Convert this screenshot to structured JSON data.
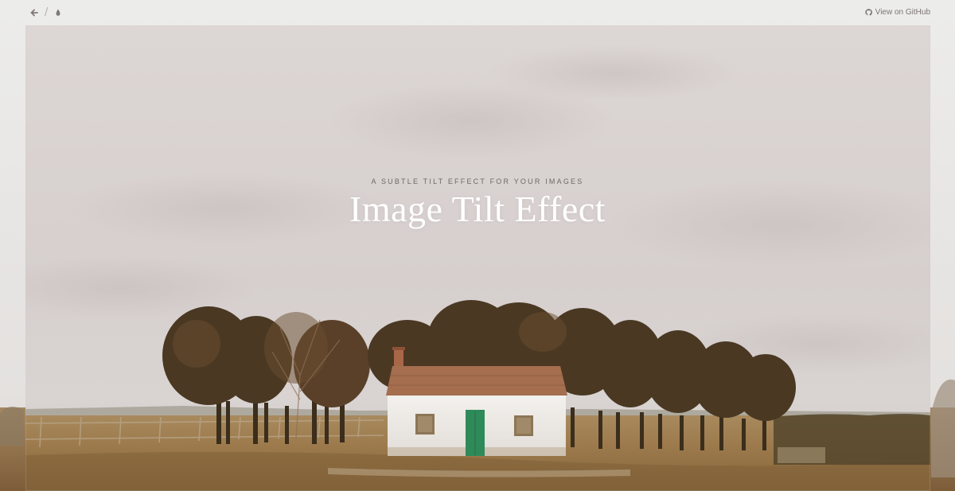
{
  "nav": {
    "back_icon": "arrow-left-icon",
    "separator": "/",
    "drop_icon": "drop-icon",
    "github_label": "View on GitHub",
    "github_icon": "github-icon"
  },
  "hero": {
    "tagline": "A SUBTLE TILT EFFECT FOR YOUR IMAGES",
    "title": "Image Tilt Effect"
  },
  "colors": {
    "sky": "#d9d3d1",
    "field": "#9a7a4e",
    "house_wall": "#efece8",
    "roof": "#a06a4a",
    "door": "#2f8a5a",
    "tree": "#4a3a24"
  }
}
